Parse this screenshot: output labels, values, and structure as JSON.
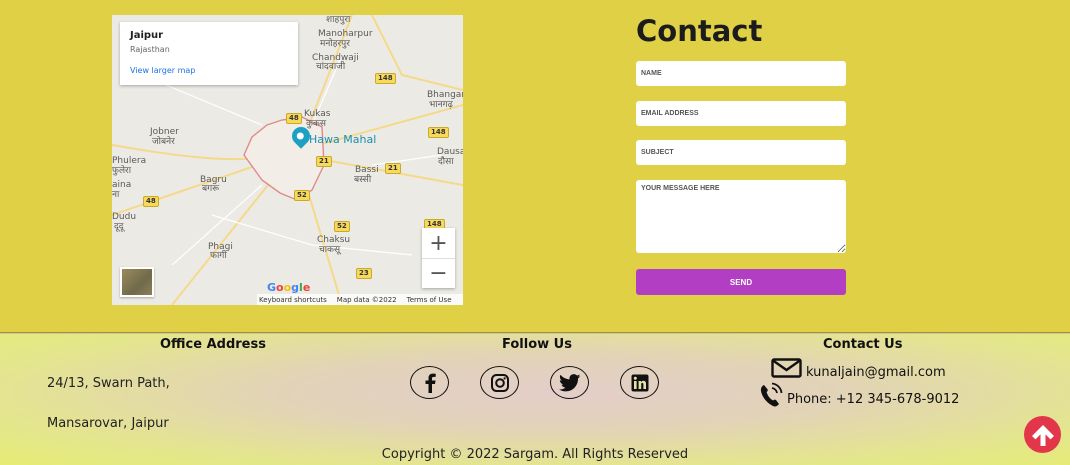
{
  "map": {
    "place_title": "Jaipur",
    "place_subtitle": "Rajasthan",
    "view_larger_link": "View larger map",
    "poi_label": "Hawa Mahal",
    "labels": [
      {
        "text": "शाहपुरा"
      },
      {
        "text": "Manoharpur"
      },
      {
        "text": "मनोहरपुर"
      },
      {
        "text": "Chandwaji"
      },
      {
        "text": "चांदवाजी"
      },
      {
        "text": "Bhangar"
      },
      {
        "text": "भानगढ़"
      },
      {
        "text": "Kukas"
      },
      {
        "text": "कुकस"
      },
      {
        "text": "Jobner"
      },
      {
        "text": "जोबनेर"
      },
      {
        "text": "Phulera"
      },
      {
        "text": "फुलेरा"
      },
      {
        "text": "Bagru"
      },
      {
        "text": "बगरू"
      },
      {
        "text": "aina"
      },
      {
        "text": "ना"
      },
      {
        "text": "Dudu"
      },
      {
        "text": "दूदू"
      },
      {
        "text": "Dausa"
      },
      {
        "text": "दौसा"
      },
      {
        "text": "Bassi"
      },
      {
        "text": "बस्सी"
      },
      {
        "text": "Chaksu"
      },
      {
        "text": "चाकसू"
      },
      {
        "text": "Phagi"
      },
      {
        "text": "फागी"
      }
    ],
    "shields": [
      "148",
      "48",
      "148",
      "21",
      "21",
      "48",
      "52",
      "52",
      "23",
      "148"
    ],
    "zoom_in": "+",
    "zoom_out": "−",
    "google": [
      "G",
      "o",
      "o",
      "g",
      "l",
      "e"
    ],
    "footer": [
      "Keyboard shortcuts",
      "Map data ©2022",
      "Terms of Use"
    ]
  },
  "contact": {
    "title": "Contact",
    "name_placeholder": "NAME",
    "email_placeholder": "EMAIL ADDRESS",
    "subject_placeholder": "SUBJECT",
    "message_placeholder": "YOUR MESSAGE HERE",
    "send_label": "SEND",
    "send_color": "#b23ec3"
  },
  "footer": {
    "office_title": "Office Address",
    "address_line1": "24/13, Swarn Path,",
    "address_line2": "Mansarovar, Jaipur",
    "follow_title": "Follow Us",
    "social_icons": [
      "facebook-icon",
      "instagram-icon",
      "twitter-icon",
      "linkedin-icon"
    ],
    "contact_title": "Contact Us",
    "email": "kunaljain@gmail.com",
    "phone": "Phone: +12 345-678-9012",
    "copyright": "Copyright © 2022 Sargam. All Rights Reserved"
  },
  "colors": {
    "top_background": "#e0d046",
    "scroll_top_button": "#e2364a",
    "map_poi": "#1ea0c3"
  }
}
